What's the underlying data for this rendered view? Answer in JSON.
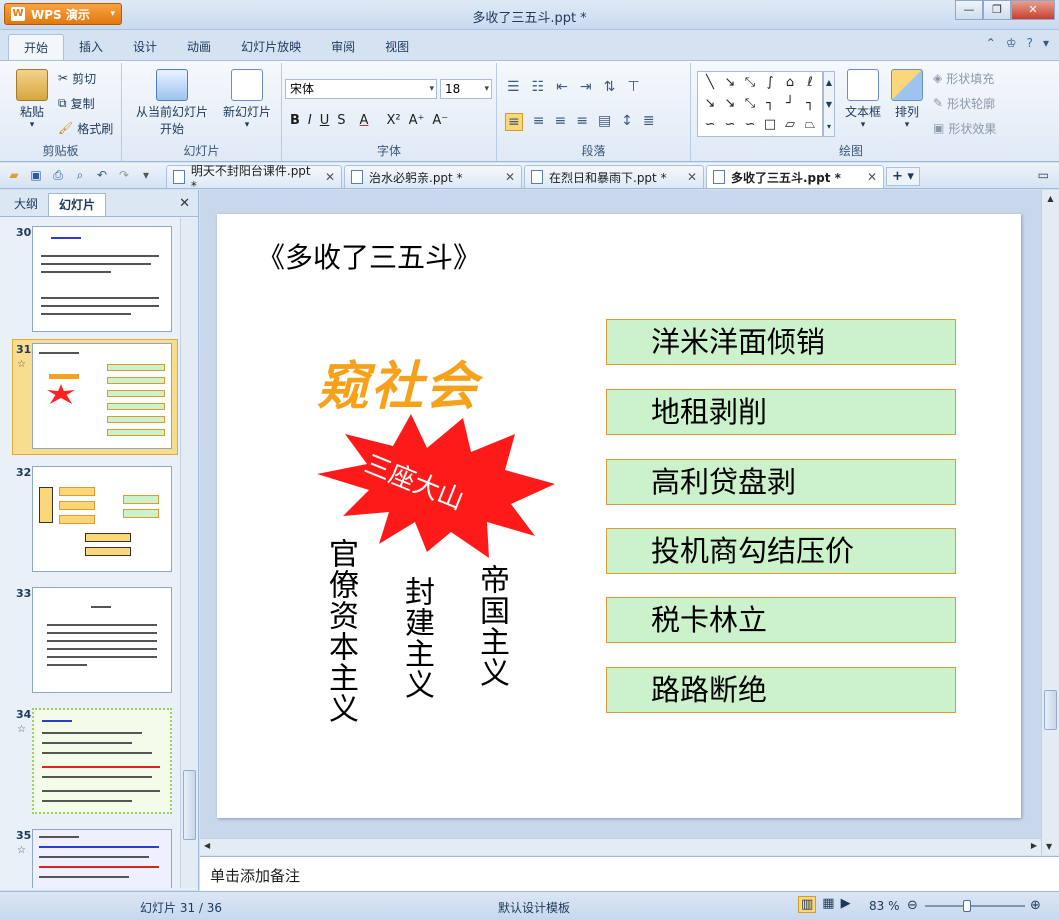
{
  "app": {
    "button_label": "WPS 演示",
    "window_title": "多收了三五斗.ppt *"
  },
  "menu": {
    "tabs": [
      "开始",
      "插入",
      "设计",
      "动画",
      "幻灯片放映",
      "审阅",
      "视图"
    ],
    "active_tab": "开始"
  },
  "ribbon": {
    "clipboard": {
      "paste": "粘贴",
      "cut": "剪切",
      "copy": "复制",
      "format_painter": "格式刷",
      "label": "剪贴板"
    },
    "slides": {
      "from_current_line1": "从当前幻灯片",
      "from_current_line2": "开始",
      "new_slide": "新幻灯片",
      "label": "幻灯片"
    },
    "font": {
      "font_name": "宋体",
      "font_size": "18",
      "bold": "B",
      "italic": "I",
      "underline": "U",
      "strike": "S",
      "color": "A",
      "superscript": "X²",
      "grow": "A⁺",
      "shrink": "A⁻",
      "label": "字体"
    },
    "paragraph": {
      "label": "段落"
    },
    "drawing": {
      "textbox": "文本框",
      "arrange": "排列",
      "shape_fill": "形状填充",
      "shape_outline": "形状轮廓",
      "shape_effect": "形状效果",
      "label": "绘图"
    }
  },
  "doc_tabs": [
    {
      "title": "明天不封阳台课件.ppt *",
      "active": false
    },
    {
      "title": "治水必躬亲.ppt *",
      "active": false
    },
    {
      "title": "在烈日和暴雨下.ppt *",
      "active": false
    },
    {
      "title": "多收了三五斗.ppt *",
      "active": true
    }
  ],
  "left_panel": {
    "tabs": [
      "大纲",
      "幻灯片"
    ],
    "active_tab": "幻灯片",
    "slides": [
      {
        "number": "30",
        "star": ""
      },
      {
        "number": "31",
        "star": "☆"
      },
      {
        "number": "32",
        "star": ""
      },
      {
        "number": "33",
        "star": ""
      },
      {
        "number": "34",
        "star": "☆"
      },
      {
        "number": "35",
        "star": "☆"
      }
    ],
    "selected": "31"
  },
  "slide": {
    "title": "《多收了三五斗》",
    "big_word": "窥社会",
    "burst_text": "三座大山",
    "vertical_words": [
      "官僚资本主义",
      "封建主义",
      "帝国主义"
    ],
    "boxes": [
      "洋米洋面倾销",
      "地租剥削",
      "高利贷盘剥",
      "投机商勾结压价",
      "税卡林立",
      "路路断绝"
    ],
    "burst_color": "#ff1a1a",
    "big_word_color": "#f7a11a",
    "box_fill": "#ccf2cc",
    "box_border": "#e09a32"
  },
  "notes": {
    "placeholder": "单击添加备注"
  },
  "status": {
    "slide_counter": "幻灯片 31 / 36",
    "template": "默认设计模板",
    "zoom": "83 %"
  }
}
